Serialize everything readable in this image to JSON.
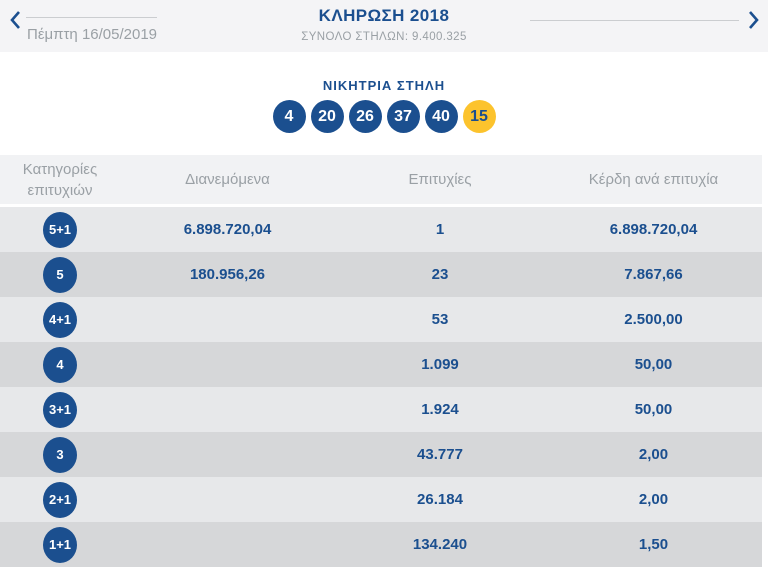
{
  "colors": {
    "primary_blue": "#1b4f8f",
    "joker_yellow": "#fcc32d",
    "text_gray": "#9aa0a5",
    "band_bg": "#f4f4f6",
    "row_light": "#e7e8ea",
    "row_dark": "#d6d7d9"
  },
  "draw_nav": {
    "title": "ΚΛΗΡΩΣΗ 2018",
    "total_columns": "ΣΥΝΟΛΟ ΣΤΗΛΩΝ: 9.400.325",
    "date": "Πέμπτη 16/05/2019"
  },
  "winning_column": {
    "title": "ΝΙΚΗΤΡΙΑ ΣΤΗΛΗ",
    "numbers": [
      "4",
      "20",
      "26",
      "37",
      "40"
    ],
    "joker": "15"
  },
  "results_table": {
    "headers": {
      "categories": "Κατηγορίες επιτυχιών",
      "distributed": "Διανεμόμενα",
      "winners": "Επιτυχίες",
      "prize_per_winner": "Κέρδη ανά επιτυχία"
    },
    "rows": [
      {
        "category": "5+1",
        "distributed": "6.898.720,04",
        "winners": "1",
        "prize": "6.898.720,04"
      },
      {
        "category": "5",
        "distributed": "180.956,26",
        "winners": "23",
        "prize": "7.867,66"
      },
      {
        "category": "4+1",
        "distributed": "",
        "winners": "53",
        "prize": "2.500,00"
      },
      {
        "category": "4",
        "distributed": "",
        "winners": "1.099",
        "prize": "50,00"
      },
      {
        "category": "3+1",
        "distributed": "",
        "winners": "1.924",
        "prize": "50,00"
      },
      {
        "category": "3",
        "distributed": "",
        "winners": "43.777",
        "prize": "2,00"
      },
      {
        "category": "2+1",
        "distributed": "",
        "winners": "26.184",
        "prize": "2,00"
      },
      {
        "category": "1+1",
        "distributed": "",
        "winners": "134.240",
        "prize": "1,50"
      }
    ]
  }
}
